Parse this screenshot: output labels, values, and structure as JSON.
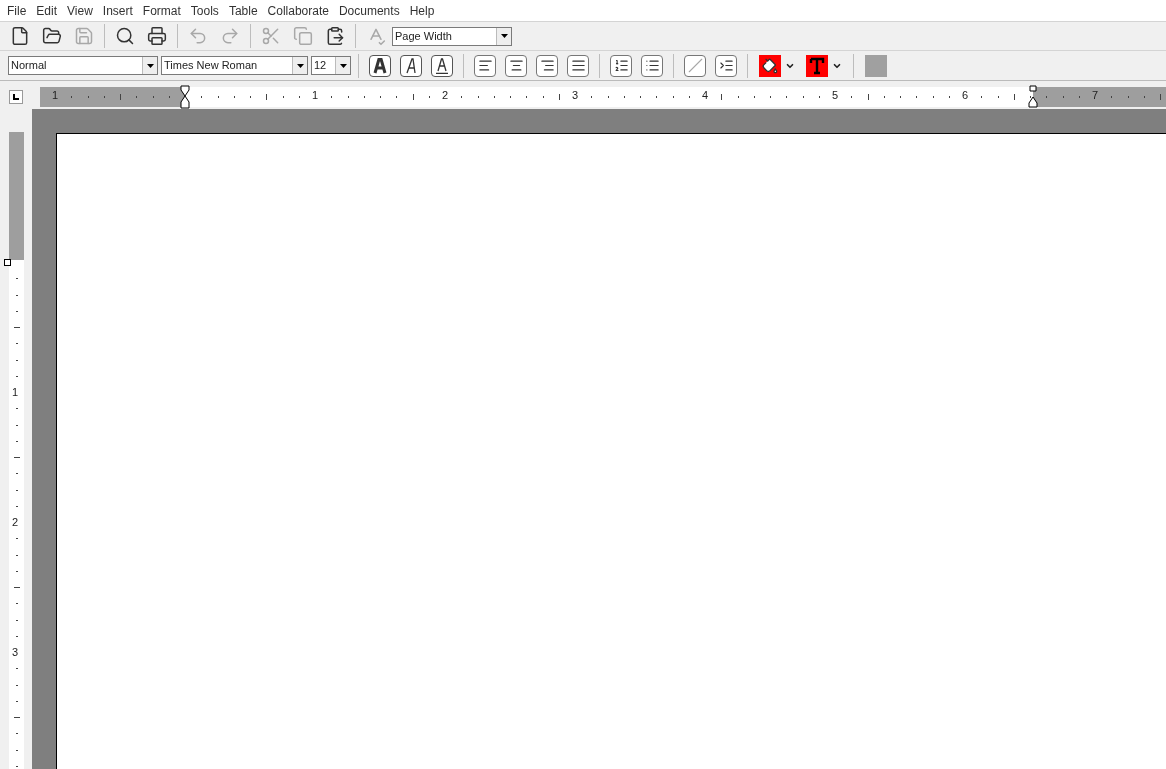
{
  "menu": [
    "File",
    "Edit",
    "View",
    "Insert",
    "Format",
    "Tools",
    "Table",
    "Collaborate",
    "Documents",
    "Help"
  ],
  "toolbar": [
    {
      "kind": "new",
      "disabled": false
    },
    {
      "kind": "open",
      "disabled": false
    },
    {
      "kind": "save",
      "disabled": true
    },
    {
      "kind": "sep"
    },
    {
      "kind": "preview",
      "disabled": false
    },
    {
      "kind": "print",
      "disabled": false
    },
    {
      "kind": "sep"
    },
    {
      "kind": "undo",
      "disabled": true
    },
    {
      "kind": "redo",
      "disabled": true
    },
    {
      "kind": "sep"
    },
    {
      "kind": "cut",
      "disabled": true
    },
    {
      "kind": "copy",
      "disabled": true
    },
    {
      "kind": "paste",
      "disabled": false
    },
    {
      "kind": "sep"
    },
    {
      "kind": "spell",
      "disabled": true
    }
  ],
  "zoom": {
    "value": "Page Width"
  },
  "format_bar": {
    "style": "Normal",
    "font": "Times New Roman",
    "size": "12"
  },
  "format_tools": [
    {
      "kind": "sep"
    },
    {
      "kind": "bold",
      "disabled": false
    },
    {
      "kind": "italic",
      "disabled": false
    },
    {
      "kind": "underline",
      "disabled": false
    },
    {
      "kind": "sep"
    },
    {
      "kind": "left",
      "disabled": false
    },
    {
      "kind": "center",
      "disabled": false
    },
    {
      "kind": "right",
      "disabled": false
    },
    {
      "kind": "justify",
      "disabled": false
    },
    {
      "kind": "sep"
    },
    {
      "kind": "numbered",
      "disabled": false
    },
    {
      "kind": "bullets",
      "disabled": false
    },
    {
      "kind": "sep"
    },
    {
      "kind": "line",
      "disabled": true
    },
    {
      "kind": "indent",
      "disabled": false
    },
    {
      "kind": "sep"
    },
    {
      "kind": "fill",
      "disabled": false
    },
    {
      "kind": "textcolor",
      "disabled": false
    },
    {
      "kind": "sep"
    },
    {
      "kind": "block",
      "disabled": true
    }
  ],
  "ruler": {
    "labels": [
      "1",
      "1",
      "2",
      "3",
      "4",
      "5",
      "6",
      "7"
    ]
  },
  "vertical_ruler": {
    "labels": [
      "1",
      "2",
      "3"
    ]
  }
}
